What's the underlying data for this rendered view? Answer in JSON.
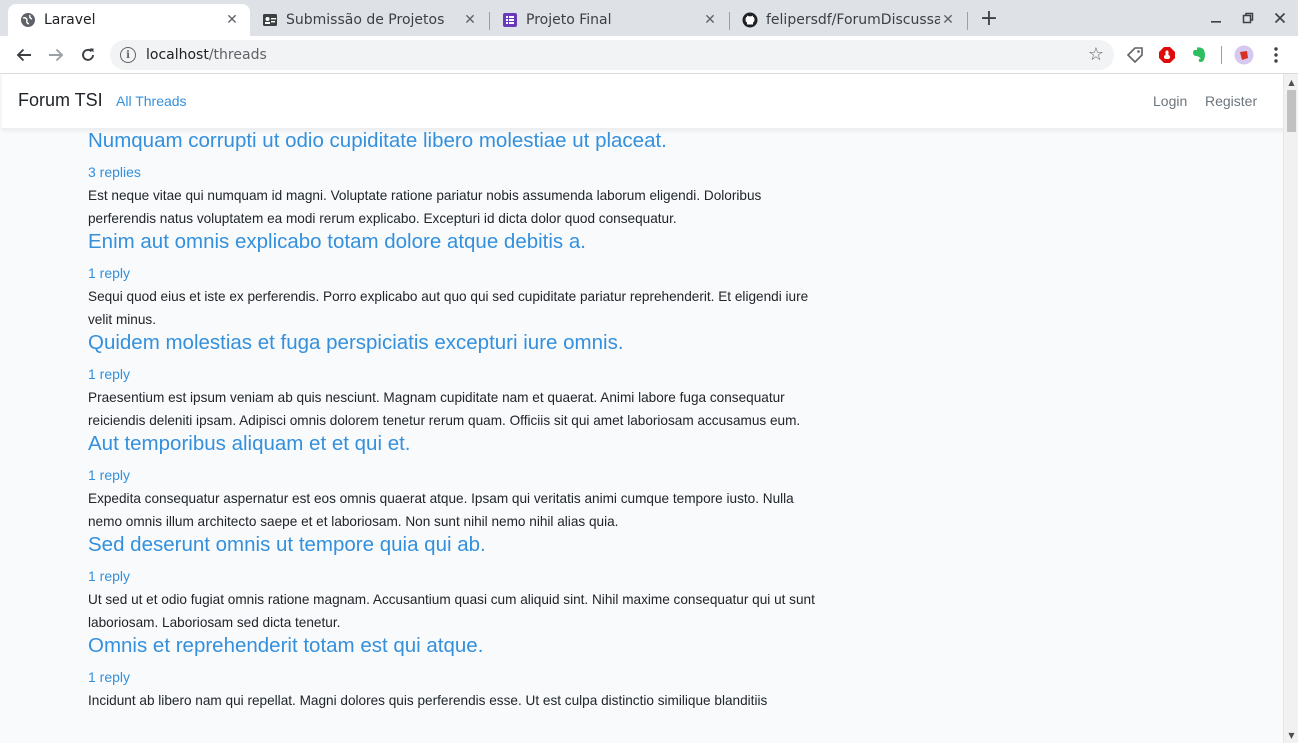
{
  "browser": {
    "tabs": [
      {
        "title": "Laravel",
        "icon": "globe-icon",
        "active": true
      },
      {
        "title": "Submissão de Projetos",
        "icon": "id-card-icon",
        "active": false
      },
      {
        "title": "Projeto Final",
        "icon": "form-icon",
        "active": false
      },
      {
        "title": "felipersdf/ForumDiscussa",
        "icon": "github-icon",
        "active": false
      }
    ],
    "address": {
      "host": "localhost",
      "path": "/threads"
    }
  },
  "navbar": {
    "brand": "Forum TSI",
    "all_threads": "All Threads",
    "login": "Login",
    "register": "Register"
  },
  "threads": [
    {
      "title": "Numquam corrupti ut odio cupiditate libero molestiae ut placeat.",
      "replies": "3 replies",
      "body": "Est neque vitae qui numquam id magni. Voluptate ratione pariatur nobis assumenda laborum eligendi. Doloribus perferendis natus voluptatem ea modi rerum explicabo. Excepturi id dicta dolor quod consequatur."
    },
    {
      "title": "Enim aut omnis explicabo totam dolore atque debitis a.",
      "replies": "1 reply",
      "body": "Sequi quod eius et iste ex perferendis. Porro explicabo aut quo qui sed cupiditate pariatur reprehenderit. Et eligendi iure velit minus."
    },
    {
      "title": "Quidem molestias et fuga perspiciatis excepturi iure omnis.",
      "replies": "1 reply",
      "body": "Praesentium est ipsum veniam ab quis nesciunt. Magnam cupiditate nam et quaerat. Animi labore fuga consequatur reiciendis deleniti ipsam. Adipisci omnis dolorem tenetur rerum quam. Officiis sit qui amet laboriosam accusamus eum."
    },
    {
      "title": "Aut temporibus aliquam et et qui et.",
      "replies": "1 reply",
      "body": "Expedita consequatur aspernatur est eos omnis quaerat atque. Ipsam qui veritatis animi cumque tempore iusto. Nulla nemo omnis illum architecto saepe et et laboriosam. Non sunt nihil nemo nihil alias quia."
    },
    {
      "title": "Sed deserunt omnis ut tempore quia qui ab.",
      "replies": "1 reply",
      "body": "Ut sed ut et odio fugiat omnis ratione magnam. Accusantium quasi cum aliquid sint. Nihil maxime consequatur qui ut sunt laboriosam. Laboriosam sed dicta tenetur."
    },
    {
      "title": "Omnis et reprehenderit totam est qui atque.",
      "replies": "1 reply",
      "body": "Incidunt ab libero nam qui repellat. Magni dolores quis perferendis esse. Ut est culpa distinctio similique blanditiis"
    }
  ],
  "colors": {
    "link": "#3490dc",
    "text": "#212529",
    "background": "#f8fafc"
  }
}
